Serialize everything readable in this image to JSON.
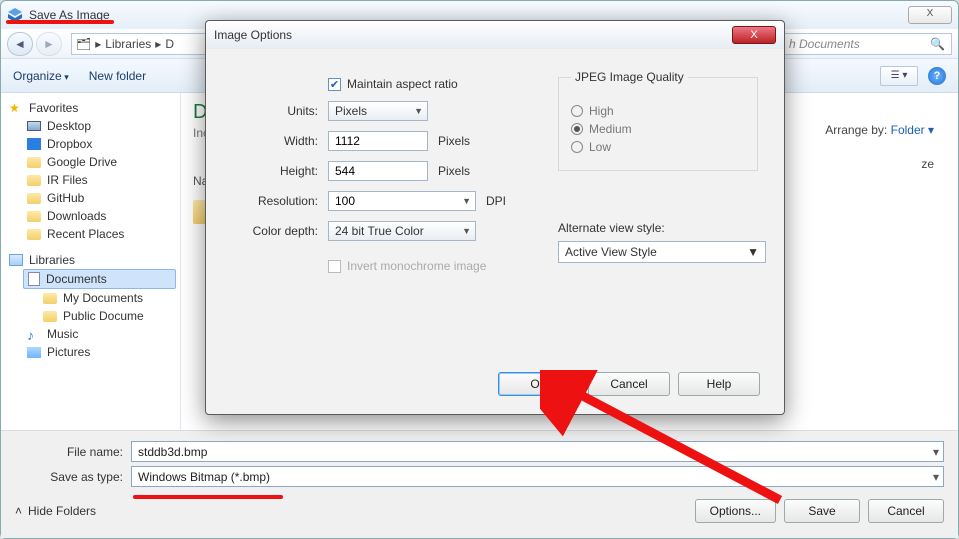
{
  "window": {
    "title": "Save As Image",
    "close_x": "X"
  },
  "breadcrumb": {
    "root_icon": "computer",
    "seg1": "Libraries",
    "seg2_first": "D",
    "search_placeholder": "Search Documents",
    "search_partial_prefix": "h Documents"
  },
  "toolbar": {
    "organize": "Organize",
    "new_folder": "New folder"
  },
  "tree": {
    "favorites": "Favorites",
    "desktop": "Desktop",
    "dropbox": "Dropbox",
    "gdrive": "Google Drive",
    "irfiles": "IR Files",
    "github": "GitHub",
    "downloads": "Downloads",
    "recent": "Recent Places",
    "libraries": "Libraries",
    "documents": "Documents",
    "mydocs": "My Documents",
    "pubdocs": "Public Docume",
    "music": "Music",
    "pictures": "Pictures"
  },
  "rpane": {
    "title_first": "D",
    "includes_prefix": "Inc",
    "name_col_prefix": "Na",
    "arrange_lbl": "Arrange by:",
    "arrange_val": "Folder ▾",
    "size_suffix": "ze"
  },
  "file": {
    "name_label": "File name:",
    "name_value": "stddb3d.bmp",
    "type_label": "Save as type:",
    "type_value": "Windows Bitmap (*.bmp)"
  },
  "bottom_buttons": {
    "hide": "Hide Folders",
    "options": "Options...",
    "save": "Save",
    "cancel": "Cancel"
  },
  "modal": {
    "title": "Image Options",
    "close_x": "X",
    "maintain": "Maintain aspect ratio",
    "units_lbl": "Units:",
    "units_val": "Pixels",
    "width_lbl": "Width:",
    "width_val": "1112",
    "width_unit": "Pixels",
    "height_lbl": "Height:",
    "height_val": "544",
    "height_unit": "Pixels",
    "res_lbl": "Resolution:",
    "res_val": "100",
    "res_unit": "DPI",
    "depth_lbl": "Color depth:",
    "depth_val": "24 bit True Color",
    "invert": "Invert monochrome image",
    "jpeg_legend": "JPEG Image Quality",
    "jpeg_high": "High",
    "jpeg_med": "Medium",
    "jpeg_low": "Low",
    "alt_lbl": "Alternate view style:",
    "alt_val": "Active View Style",
    "ok": "OK",
    "cancel": "Cancel",
    "help": "Help"
  }
}
